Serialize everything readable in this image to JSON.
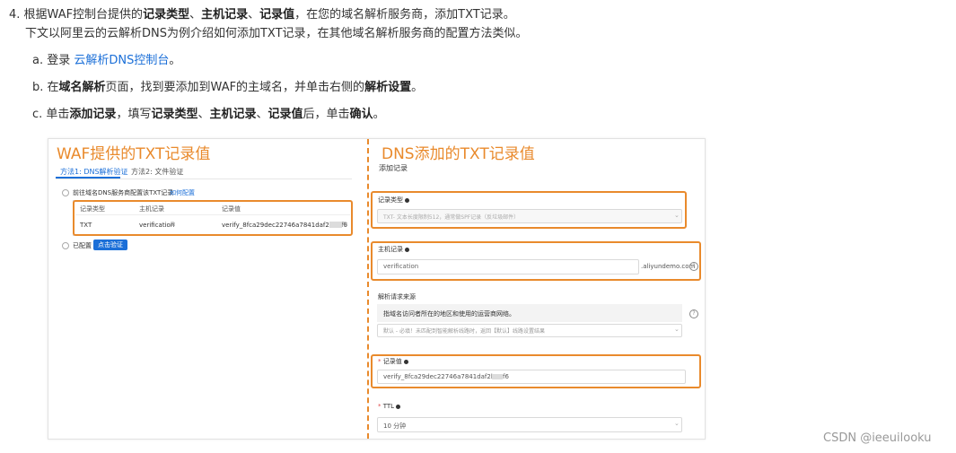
{
  "step": {
    "num": "4.",
    "l1_a": "根据WAF控制台提供的",
    "l1_b1": "记录类型",
    "l1_sep1": "、",
    "l1_b2": "主机记录",
    "l1_sep2": "、",
    "l1_b3": "记录值",
    "l1_c": "，在您的域名解析服务商，添加TXT记录。",
    "l2": "下文以阿里云的云解析DNS为例介绍如何添加TXT记录，在其他域名解析服务商的配置方法类似。"
  },
  "substeps": {
    "a_prefix": "a. 登录 ",
    "a_link": "云解析DNS控制台",
    "a_suffix": "。",
    "b_prefix": "b. 在",
    "b_bold1": "域名解析",
    "b_mid": "页面，找到要添加到WAF的主域名，并单击右侧的",
    "b_bold2": "解析设置",
    "b_suffix": "。",
    "c_prefix": "c. 单击",
    "c_b1": "添加记录",
    "c_m1": "，填写",
    "c_b2": "记录类型",
    "c_s1": "、",
    "c_b3": "主机记录",
    "c_s2": "、",
    "c_b4": "记录值",
    "c_m2": "后，单击",
    "c_b5": "确认",
    "c_s3": "。"
  },
  "figure": {
    "left": {
      "title": "WAF提供的TXT记录值",
      "tab1": "方法1: DNS解析验证",
      "tab2": "方法2: 文件验证",
      "radio1": "前往域名DNS服务商配置该TXT记录",
      "how_link": "如何配置",
      "col1": "记录类型",
      "col2": "主机记录",
      "col3": "记录值",
      "row_type": "TXT",
      "row_host": "verification",
      "row_value": "verify_8fca29dec22746a7841daf2b3af6",
      "radio2": "已配置",
      "verify_btn": "点击验证"
    },
    "right": {
      "title": "DNS添加的TXT记录值",
      "panel_title": "添加记录",
      "type_label": "记录类型",
      "type_value": "TXT- 文本长度限制512，通常做SPF记录（反垃圾邮件）",
      "host_label": "主机记录",
      "host_value": "verification",
      "host_suffix": ".aliyundemo.com",
      "source_label": "解析请求来源",
      "source_desc": "指域名访问者所在的地区和使用的运营商网络。",
      "source_value": "默认 - 必填！未匹配到智能解析线路时，返回【默认】线路设置结果",
      "value_label": "记录值",
      "value_value": "verify_8fca29dec22746a7841daf2b3af6",
      "ttl_label": "TTL",
      "ttl_value": "10 分钟"
    }
  },
  "watermark": "CSDN @ieeuilooku",
  "colors": {
    "accent_orange": "#e98a2c",
    "link_blue": "#1b6fd8",
    "button_blue": "#1b6fd8"
  }
}
